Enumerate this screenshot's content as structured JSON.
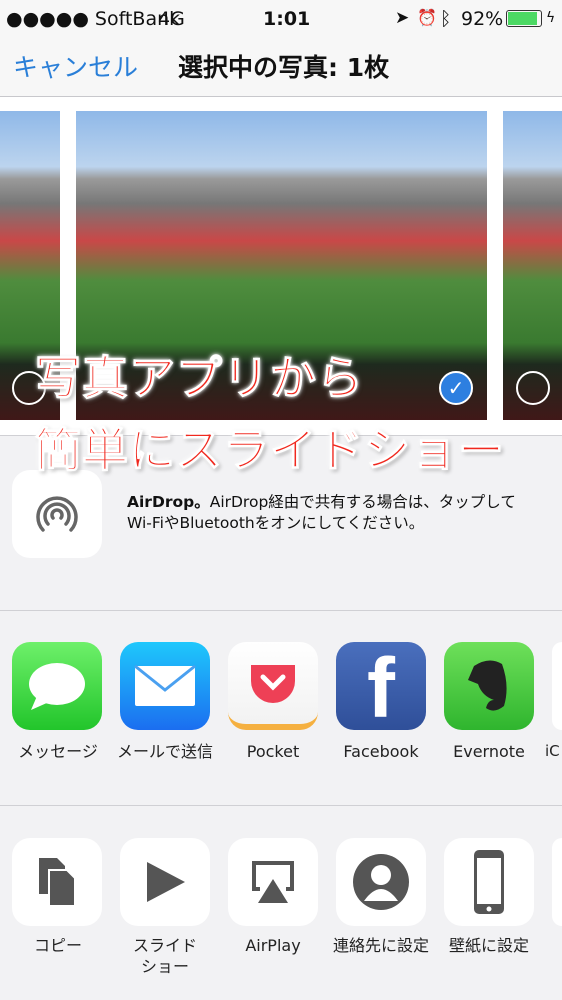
{
  "status": {
    "carrier": "●●●●● SoftBank",
    "network": "4G",
    "time": "1:01",
    "battery": "92%",
    "battery_level": 0.92
  },
  "nav": {
    "cancel": "キャンセル",
    "title": "選択中の写真: 1枚"
  },
  "overlay": {
    "line1": "写真アプリから",
    "line2": "簡単にスライドショー"
  },
  "airdrop": {
    "title": "AirDrop。",
    "text1": "AirDrop経由で共有する場合は、タップして",
    "text2": "Wi-FiやBluetoothをオンにしてください。"
  },
  "apps": [
    {
      "label": "メッセージ"
    },
    {
      "label": "メールで送信"
    },
    {
      "label": "Pocket"
    },
    {
      "label": "Facebook"
    },
    {
      "label": "Evernote"
    },
    {
      "label": "iC"
    }
  ],
  "actions": [
    {
      "label": "コピー"
    },
    {
      "label": "スライド\nショー",
      "l1": "スライド",
      "l2": "ショー"
    },
    {
      "label": "AirPlay"
    },
    {
      "label": "連絡先に設定"
    },
    {
      "label": "壁紙に設定"
    }
  ],
  "colors": {
    "accent": "#2a7fd8",
    "overlay_text": "#f0281e",
    "battery": "#4cd964"
  }
}
